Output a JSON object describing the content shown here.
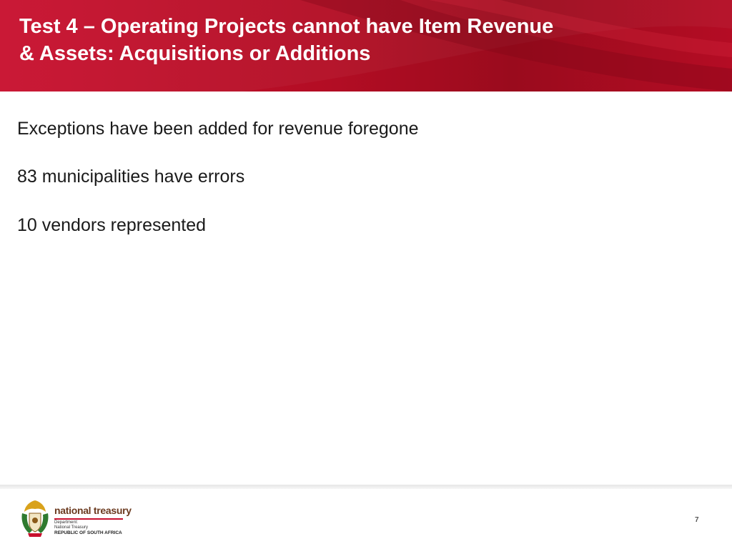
{
  "slide": {
    "title_line1": "Test 4 – Operating Projects cannot have Item Revenue",
    "title_line2": "& Assets: Acquisitions or Additions",
    "bullets": [
      "Exceptions have been added for revenue foregone",
      "83 municipalities have errors",
      "10 vendors represented"
    ]
  },
  "footer": {
    "logo_name": "national treasury",
    "logo_line1": "Department:",
    "logo_line2": "National Treasury",
    "logo_line3": "REPUBLIC OF SOUTH AFRICA",
    "page_number": "7"
  },
  "colors": {
    "header_red": "#c8102e",
    "header_dark_red": "#9a0b1d",
    "text": "#1a1a1a"
  }
}
